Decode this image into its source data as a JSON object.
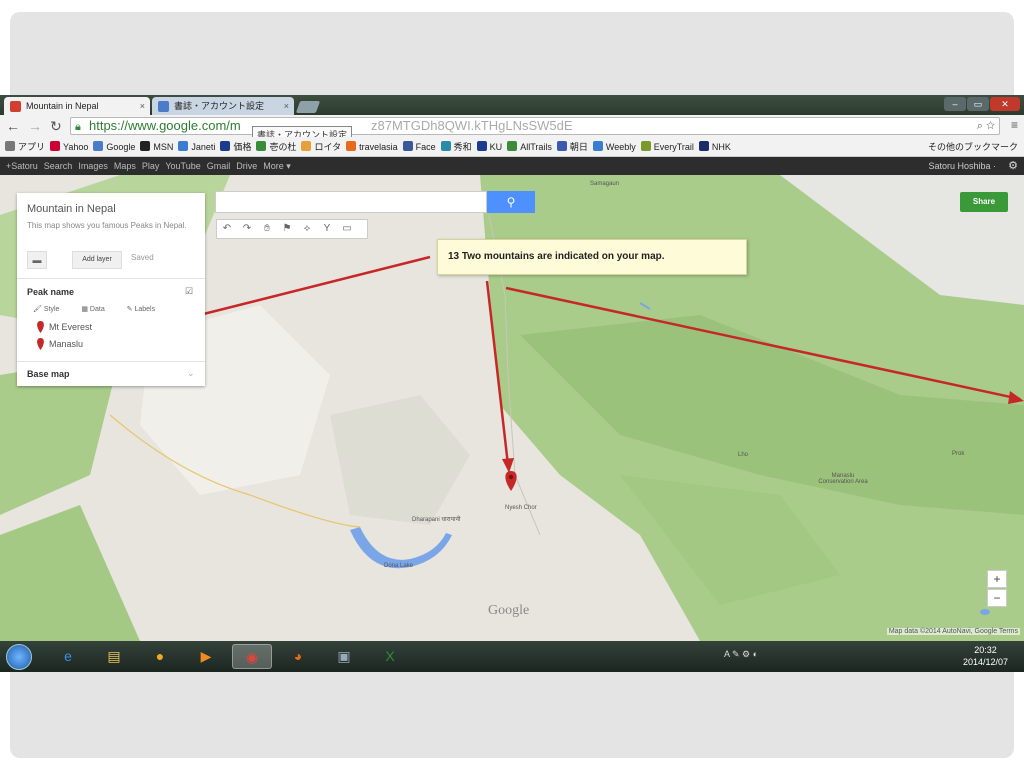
{
  "browser": {
    "tabs": [
      {
        "label": "Mountain in Nepal",
        "icon": "maps-favicon-icon",
        "color": "#d23f31"
      },
      {
        "label": "書誌・アカウント設定",
        "icon": "page-favicon-icon",
        "color": "#4a7cc7"
      }
    ],
    "tab_close": "×",
    "tooltip": "書誌・アカウント設定",
    "url_main": "https://www.google.com/m",
    "url_tail": "z87MTGDh8QWI.kTHgLNsSW5dE",
    "bookmarks": [
      {
        "label": "アプリ",
        "color": "#777777"
      },
      {
        "label": "Yahoo",
        "color": "#cc0033"
      },
      {
        "label": "Google",
        "color": "#4a7cc7"
      },
      {
        "label": "MSN",
        "color": "#222222"
      },
      {
        "label": "Janeti",
        "color": "#3b7bd0"
      },
      {
        "label": "価格",
        "color": "#1a3c8a"
      },
      {
        "label": "壱の杜",
        "color": "#3a8c3a"
      },
      {
        "label": "ロイタ",
        "color": "#e8a13a"
      },
      {
        "label": "travelasia",
        "color": "#e86a1a"
      },
      {
        "label": "Face",
        "color": "#3b5998"
      },
      {
        "label": "秀和",
        "color": "#2a8aa8"
      },
      {
        "label": "KU",
        "color": "#1a3c8a"
      },
      {
        "label": "AllTrails",
        "color": "#3a8c3a"
      },
      {
        "label": "朝日",
        "color": "#3a5ab0"
      },
      {
        "label": "Weebly",
        "color": "#3b7bd0"
      },
      {
        "label": "EveryTrail",
        "color": "#7a9a2a"
      },
      {
        "label": "NHK",
        "color": "#1a2a6a"
      }
    ],
    "other_bookmarks": "その他のブックマーク"
  },
  "google_bar": {
    "items": [
      "+Satoru",
      "Search",
      "Images",
      "Maps",
      "Play",
      "YouTube",
      "Gmail",
      "Drive",
      "More ▾"
    ],
    "user": "Satoru Hoshiba ·"
  },
  "map_panel": {
    "title": "Mountain in Nepal",
    "description": "This map shows you famous Peaks in Nepal.",
    "add_layer": "Add layer",
    "saved": "Saved",
    "layer_name": "Peak name",
    "options": [
      "Style",
      "Data",
      "Labels"
    ],
    "places": [
      "Mt Everest",
      "Manaslu"
    ],
    "base_map": "Base map"
  },
  "map": {
    "share": "Share",
    "callout": "13 Two mountains are indicated on your map.",
    "labels": [
      "Samagaun",
      "Dharapani धारापानी",
      "Dona Lake",
      "Nyesh Chor",
      "Lho",
      "Manaslu Conservation Area",
      "Prok"
    ],
    "google": "Google",
    "zoom_in": "+",
    "zoom_out": "−",
    "attribution": "Map data ©2014 AutoNavi, Google   Terms",
    "arrow_color": "#c62828",
    "pin_color": "#c62828"
  },
  "taskbar": {
    "tray_text": "A ✎ ⚙ ◐",
    "time": "20:32",
    "date": "2014/12/07"
  }
}
